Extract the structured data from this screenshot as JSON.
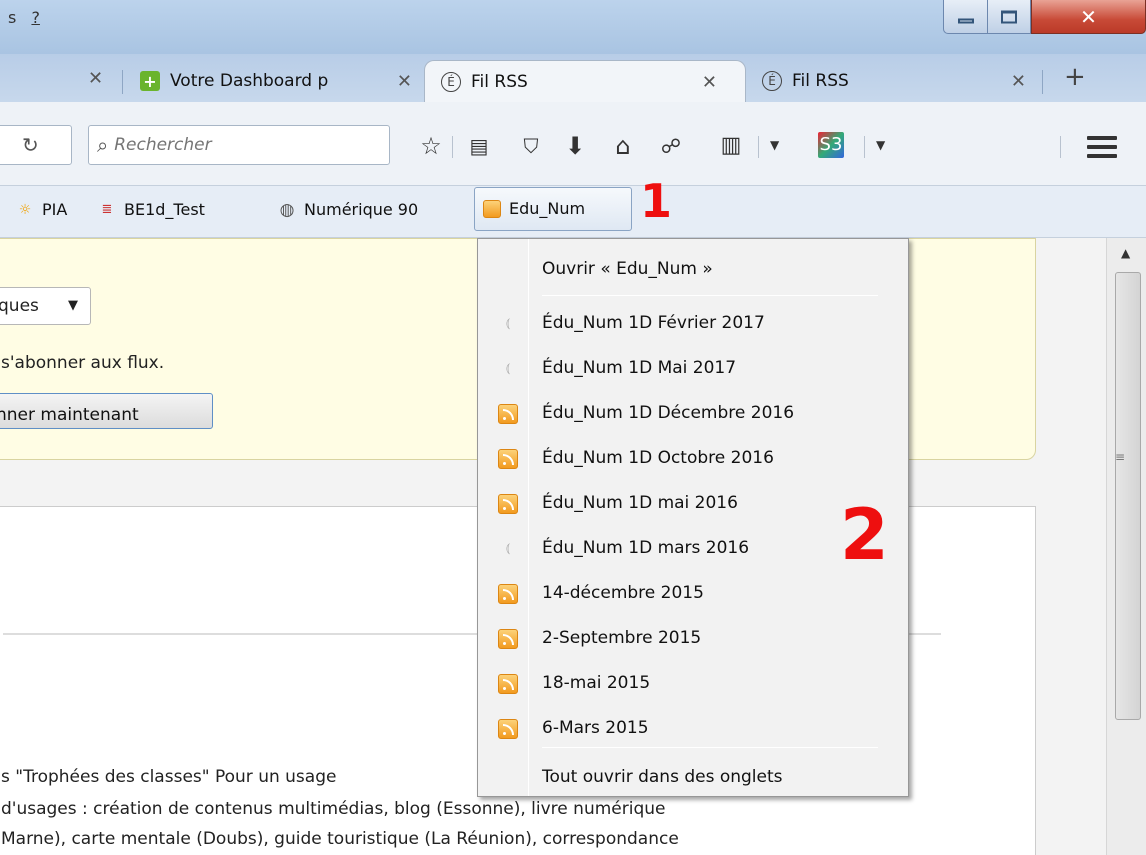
{
  "titlebar": {
    "menu_fragment_1": "s",
    "menu_fragment_2": "?"
  },
  "tabs": [
    {
      "label": "Votre Dashboard p",
      "favicon": "green-plus-icon",
      "active": false
    },
    {
      "label": "Fil RSS",
      "favicon": "e-circle-icon",
      "active": true
    },
    {
      "label": "Fil RSS",
      "favicon": "e-circle-icon",
      "active": false
    }
  ],
  "newtab": "+",
  "search": {
    "placeholder": "Rechercher"
  },
  "bookmarks": [
    {
      "label": "PIA",
      "icon": "sun-icon"
    },
    {
      "label": "BE1d_Test",
      "icon": "feed-e-icon"
    },
    {
      "label": "Numérique 90",
      "icon": "globe-icon"
    },
    {
      "label": "Edu_Num",
      "icon": "rss-icon"
    }
  ],
  "page": {
    "select_value": "ques",
    "notice_text": "s'abonner aux flux.",
    "subscribe_button": "nner maintenant",
    "body_lines": [
      "s \"Trophées des classes\" Pour un usage",
      " d'usages : création de contenus multimédias, blog (Essonne), livre numérique",
      "Marne), carte mentale (Doubs), guide touristique (La Réunion), correspondance"
    ]
  },
  "menu": {
    "open_item": "Ouvrir « Edu_Num »",
    "items": [
      {
        "label": "Édu_Num 1D Février 2017",
        "icon": "rss-grey-icon"
      },
      {
        "label": "Édu_Num 1D Mai 2017",
        "icon": "rss-grey-icon"
      },
      {
        "label": "Édu_Num 1D Décembre 2016",
        "icon": "rss-orange-icon"
      },
      {
        "label": "Édu_Num 1D Octobre 2016",
        "icon": "rss-orange-icon"
      },
      {
        "label": "Édu_Num 1D mai 2016",
        "icon": "rss-orange-icon"
      },
      {
        "label": "Édu_Num 1D mars 2016",
        "icon": "rss-grey-icon"
      },
      {
        "label": "14-décembre 2015",
        "icon": "rss-orange-icon"
      },
      {
        "label": "2-Septembre 2015",
        "icon": "rss-orange-icon"
      },
      {
        "label": "18-mai 2015",
        "icon": "rss-orange-icon"
      },
      {
        "label": "6-Mars 2015",
        "icon": "rss-orange-icon"
      }
    ],
    "open_all": "Tout ouvrir dans des onglets"
  },
  "annotations": {
    "one": "1",
    "two": "2"
  },
  "colors": {
    "annotation": "#ee0f0f",
    "rss_orange": "#f29a1f",
    "tab_strip": "#b8cde7"
  }
}
